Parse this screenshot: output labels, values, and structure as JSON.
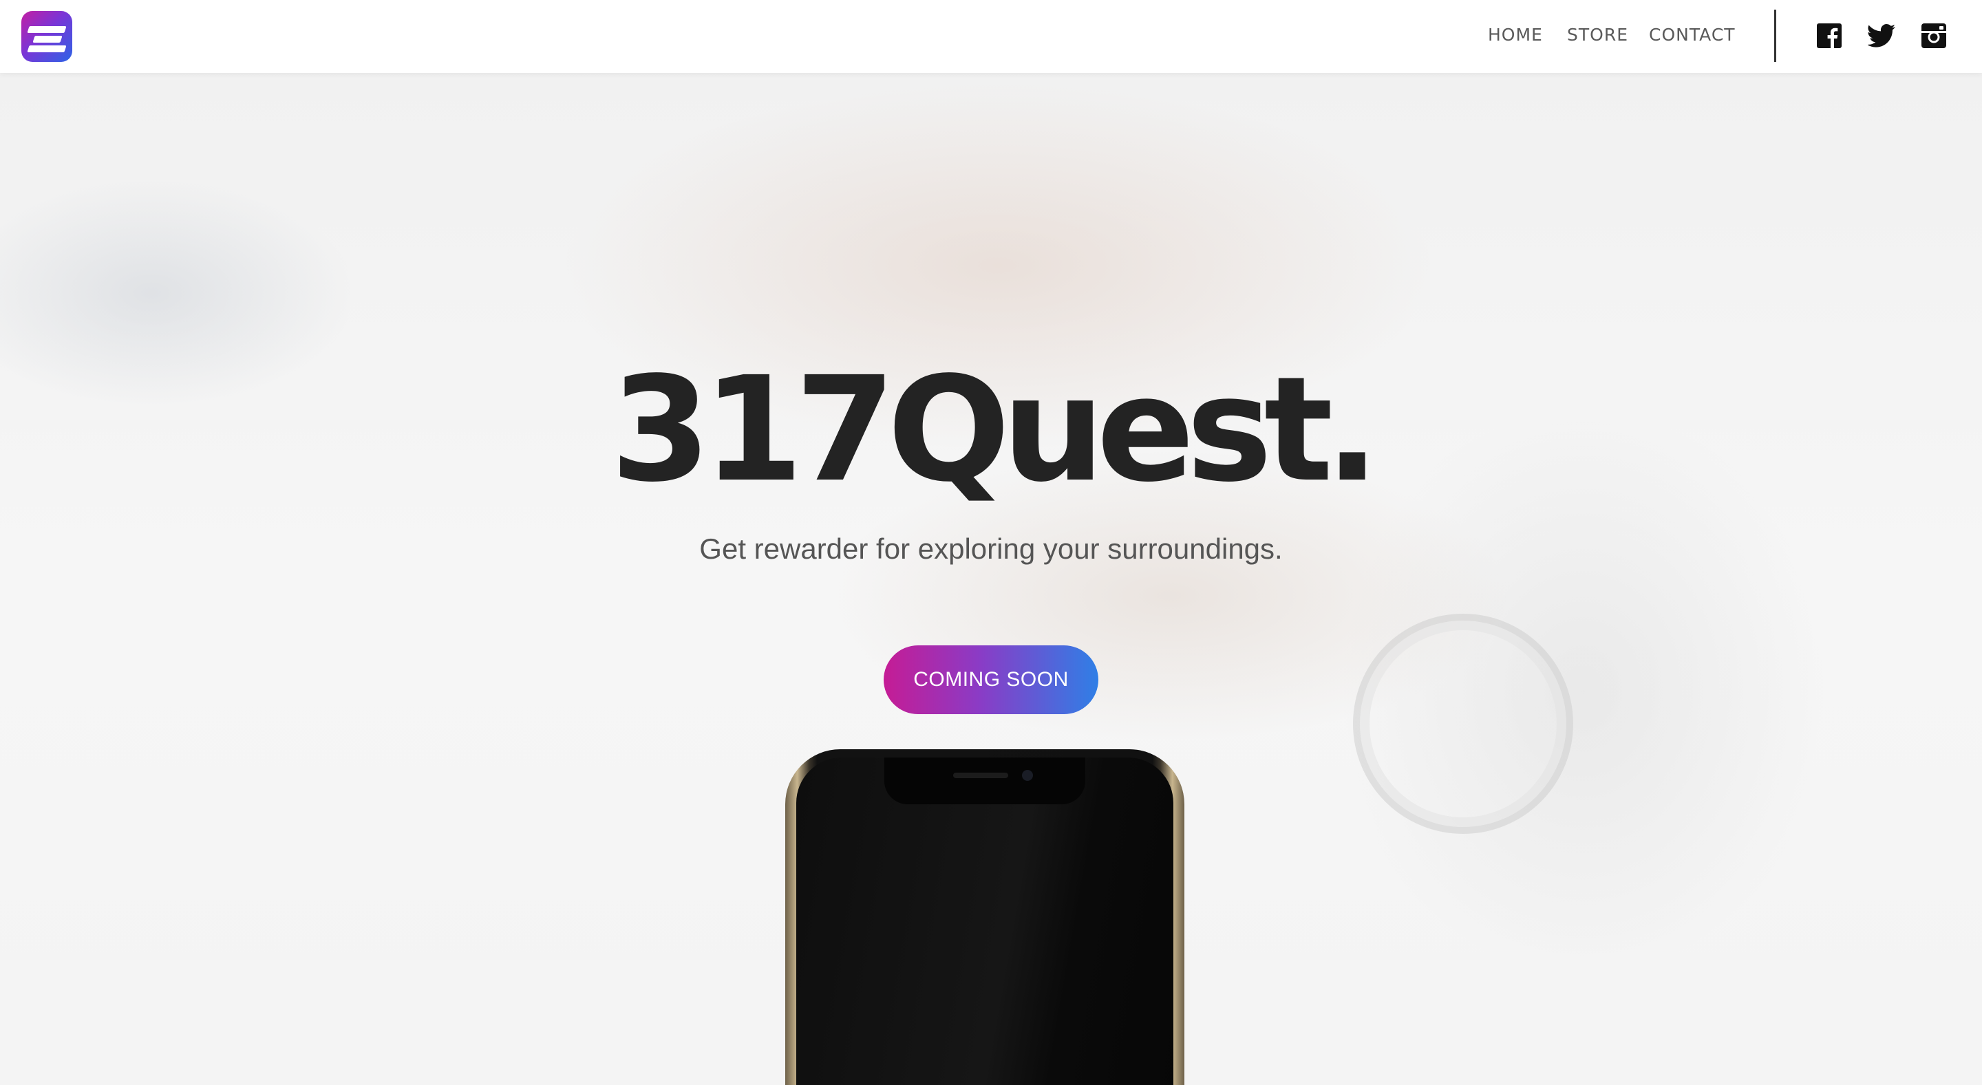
{
  "header": {
    "logo_alt": "317Quest app icon",
    "nav": {
      "home": "HOME",
      "store": "STORE",
      "contact": "CONTACT"
    },
    "social": {
      "facebook_icon": "facebook-icon",
      "twitter_icon": "twitter-icon",
      "instagram_icon": "instagram-icon"
    }
  },
  "hero": {
    "title": "317Quest.",
    "subtitle": "Get rewarder for exploring your surroundings.",
    "cta_label": "COMING SOON",
    "background_image": "hand holding smartphone with wristwatch (faded)",
    "device_image": "smartphone"
  },
  "colors": {
    "cta_gradient_start": "#c51c95",
    "cta_gradient_end": "#2f7fe6",
    "title_color": "#232323",
    "nav_color": "#5a5a5a"
  }
}
